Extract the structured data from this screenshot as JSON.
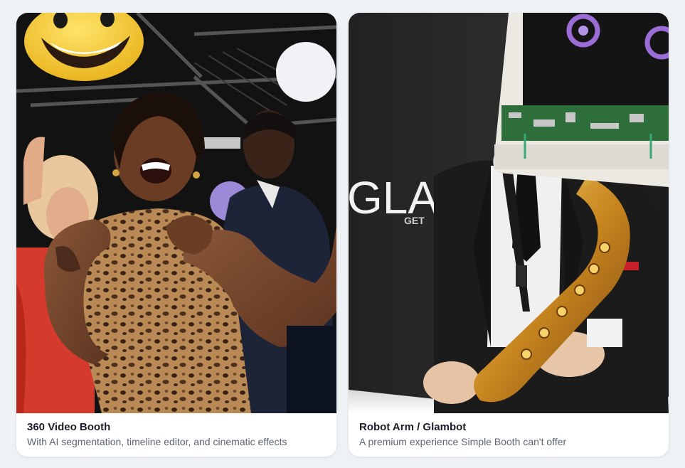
{
  "cards": [
    {
      "title": "360 Video Booth",
      "subtitle": "With AI segmentation, timeline editor, and cinematic effects",
      "media_alt": "Guests dancing at a party in a 360 video booth"
    },
    {
      "title": "Robot Arm / Glambot",
      "subtitle": "A premium experience Simple Booth can't offer",
      "media_alt": "Performer with a screen-head playing a gold saxophone",
      "backdrop_text": "GLA",
      "backdrop_subtext": "GET"
    }
  ],
  "colors": {
    "page_bg": "#eef2f5",
    "card_bg": "#ffffff",
    "title": "#1b1f2a",
    "subtitle": "#5c6470"
  }
}
